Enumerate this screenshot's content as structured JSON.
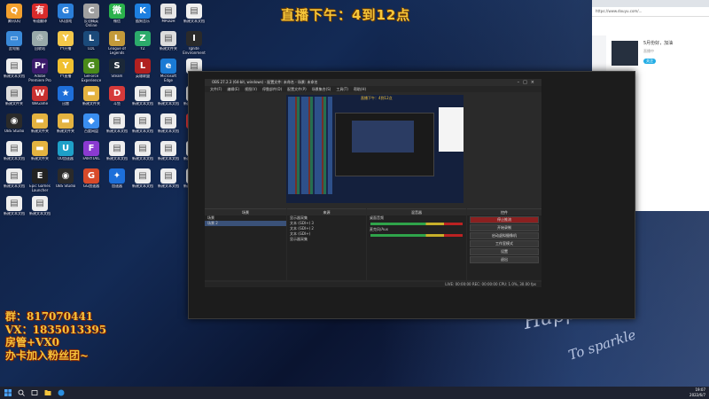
{
  "stream_overlay": {
    "title": "直播下午：4到12点",
    "promo_lines": [
      "群：817070441",
      "VX：1835013395",
      "房管+VX0",
      "办卡加入粉丝团~"
    ]
  },
  "desktop": {
    "icons": [
      {
        "label": "腾讯QQ",
        "color": "#f2a02e",
        "glyph": "Q"
      },
      {
        "label": "有道翻译",
        "color": "#d92b2b",
        "glyph": "有"
      },
      {
        "label": "QQ游戏",
        "color": "#2b7fd9",
        "glyph": "G"
      },
      {
        "label": "反恐精英Online",
        "color": "#a0a0a0",
        "glyph": "C"
      },
      {
        "label": "微信",
        "color": "#2bb24c",
        "glyph": "微"
      },
      {
        "label": "酷狗音乐",
        "color": "#1d7fe0",
        "glyph": "K"
      },
      {
        "label": "MPDDH",
        "color": "#e8e8e8",
        "glyph": "▤"
      },
      {
        "label": "新建文本文档",
        "color": "#f0f0f0",
        "glyph": "▤"
      },
      {
        "label": "此电脑",
        "color": "#3a8ad9",
        "glyph": "▭"
      },
      {
        "label": "回收站",
        "color": "#9aa",
        "glyph": "♲"
      },
      {
        "label": "YY开播",
        "color": "#f4c84a",
        "glyph": "Y"
      },
      {
        "label": "LOL",
        "color": "#1b4a7a",
        "glyph": "L"
      },
      {
        "label": "League of Legends",
        "color": "#c39a3a",
        "glyph": "L"
      },
      {
        "label": "YZ",
        "color": "#2cab6b",
        "glyph": "Z"
      },
      {
        "label": "新建文件夹",
        "color": "#ddd",
        "glyph": "▤"
      },
      {
        "label": "Ignite Environment",
        "color": "#2a2a2a",
        "glyph": "I"
      },
      {
        "label": "新建文本文档",
        "color": "#eee",
        "glyph": "▤"
      },
      {
        "label": "Adobe Premiere Pro",
        "color": "#3a1a6a",
        "glyph": "Pr"
      },
      {
        "label": "YY直播",
        "color": "#f0c030",
        "glyph": "Y"
      },
      {
        "label": "GeForce Experience",
        "color": "#4a8a1a",
        "glyph": "G"
      },
      {
        "label": "Steam",
        "color": "#1b2838",
        "glyph": "S"
      },
      {
        "label": "英雄联盟",
        "color": "#b02020",
        "glyph": "L"
      },
      {
        "label": "Microsoft Edge",
        "color": "#1a7ad4",
        "glyph": "e"
      },
      {
        "label": "比赛",
        "color": "#eee",
        "glyph": "▤"
      },
      {
        "label": "新建文件夹",
        "color": "#ddd",
        "glyph": "▤"
      },
      {
        "label": "WeGame",
        "color": "#c83030",
        "glyph": "W"
      },
      {
        "label": "迅雷",
        "color": "#1e6fd9",
        "glyph": "★"
      },
      {
        "label": "新建文件夹",
        "color": "#e4b340",
        "glyph": "▬"
      },
      {
        "label": "斗鱼",
        "color": "#d63a3a",
        "glyph": "D"
      },
      {
        "label": "新建文本文档",
        "color": "#eee",
        "glyph": "▤"
      },
      {
        "label": "新建文本文档",
        "color": "#eee",
        "glyph": "▤"
      },
      {
        "label": "新建文本文档",
        "color": "#eee",
        "glyph": "▤"
      },
      {
        "label": "OBS Studio",
        "color": "#2a2a2a",
        "glyph": "◉"
      },
      {
        "label": "新建文件夹",
        "color": "#e4b340",
        "glyph": "▬"
      },
      {
        "label": "新建文件夹",
        "color": "#e4b340",
        "glyph": "▬"
      },
      {
        "label": "百度网盘",
        "color": "#3a8ef0",
        "glyph": "◆"
      },
      {
        "label": "新建文本文档",
        "color": "#eee",
        "glyph": "▤"
      },
      {
        "label": "新建文本文档",
        "color": "#eee",
        "glyph": "▤"
      },
      {
        "label": "新建文本文档",
        "color": "#eee",
        "glyph": "▤"
      },
      {
        "label": "快手",
        "color": "#e83838",
        "glyph": "K"
      },
      {
        "label": "新建文本文档",
        "color": "#eee",
        "glyph": "▤"
      },
      {
        "label": "新建文件夹",
        "color": "#e4b340",
        "glyph": "▬"
      },
      {
        "label": "UU加速器",
        "color": "#1ea0c8",
        "glyph": "U"
      },
      {
        "label": "FAIRYTAIL",
        "color": "#8a3ad0",
        "glyph": "F"
      },
      {
        "label": "新建文本文档",
        "color": "#eee",
        "glyph": "▤"
      },
      {
        "label": "新建文本文档",
        "color": "#eee",
        "glyph": "▤"
      },
      {
        "label": "新建文本文档",
        "color": "#eee",
        "glyph": "▤"
      },
      {
        "label": "新建文本文档",
        "color": "#eee",
        "glyph": "▤"
      },
      {
        "label": "新建文本文档",
        "color": "#eee",
        "glyph": "▤"
      },
      {
        "label": "Epic Games Launcher",
        "color": "#222",
        "glyph": "E"
      },
      {
        "label": "OBS Studio",
        "color": "#2a2a2a",
        "glyph": "◉"
      },
      {
        "label": "GG加速器",
        "color": "#d84a2a",
        "glyph": "G"
      },
      {
        "label": "加速器",
        "color": "#1d6fd9",
        "glyph": "✦"
      },
      {
        "label": "新建文本文档",
        "color": "#eee",
        "glyph": "▤"
      },
      {
        "label": "新建文本文档",
        "color": "#eee",
        "glyph": "▤"
      },
      {
        "label": "新建文本文档",
        "color": "#eee",
        "glyph": "▤"
      },
      {
        "label": "新建文本文档",
        "color": "#eee",
        "glyph": "▤"
      },
      {
        "label": "新建文本文档",
        "color": "#eee",
        "glyph": "▤"
      }
    ]
  },
  "obs": {
    "title": "OBS 27.2.3 (64-bit, windows) - 配置文件: 未命名 - 场景: 未命名",
    "menu": [
      "文件(F)",
      "编辑(E)",
      "视图(V)",
      "停靠部件(D)",
      "配置文件(P)",
      "场景集合(S)",
      "工具(T)",
      "帮助(H)"
    ],
    "docks": {
      "scenes": {
        "title": "场景",
        "items": [
          "场景",
          "场景 2"
        ]
      },
      "sources": {
        "title": "来源",
        "items": [
          "显示器采集",
          "文本 (GDI+) 3",
          "文本 (GDI+) 2",
          "文本 (GDI+)",
          "显示器采集"
        ]
      },
      "mixer": {
        "title": "混音器",
        "channels": [
          "桌面音频",
          "麦克风/Aux"
        ]
      },
      "controls": {
        "title": "控件",
        "buttons": [
          "停止推流",
          "开始录制",
          "启动虚拟摄像机",
          "工作室模式",
          "设置",
          "退出"
        ]
      }
    },
    "status": "LIVE: 00:00:00   REC: 00:00:00   CPU: 1.0%, 30.00 fps"
  },
  "browser": {
    "url": "https://www.douyu.com/...",
    "room_title": "5月份好，加油",
    "room_sub": "直播中",
    "follow": "关注"
  },
  "taskbar": {
    "time": "19:07",
    "date": "2022/6/7"
  },
  "decor": {
    "handwriting_1": "Happiness",
    "handwriting_2": "To sparkle"
  },
  "colors": {
    "title_gold": "#f6c63a",
    "obs_bg": "#1c1c1c",
    "accent_blue": "#23ade5"
  }
}
